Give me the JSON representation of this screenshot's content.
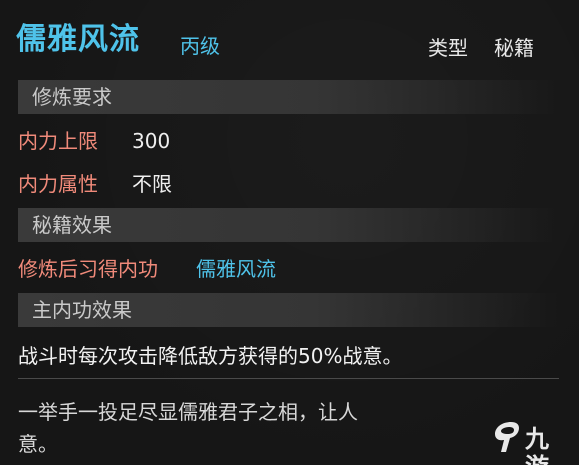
{
  "header": {
    "title": "儒雅风流",
    "grade": "丙级",
    "type_label": "类型",
    "type_value": "秘籍"
  },
  "sections": {
    "requirements": "修炼要求",
    "book_effect": "秘籍效果",
    "main_effect": "主内功效果"
  },
  "requirements": {
    "neili_limit_label": "内力上限",
    "neili_limit_value": "300",
    "neili_attr_label": "内力属性",
    "neili_attr_value": "不限"
  },
  "book_effect": {
    "learn_label": "修炼后习得内功",
    "learn_value": "儒雅风流"
  },
  "main_effect": {
    "text": "战斗时每次攻击降低敌方获得的50%战意。"
  },
  "flavor": {
    "line1": "一举手一投足尽显儒雅君子之相，让人",
    "line2": "意。"
  },
  "watermark": {
    "text": "九游"
  },
  "colors": {
    "title": "#4fc3ea",
    "label": "#f08a7a",
    "value": "#efefef",
    "section_bg": "#3a3a3a"
  }
}
